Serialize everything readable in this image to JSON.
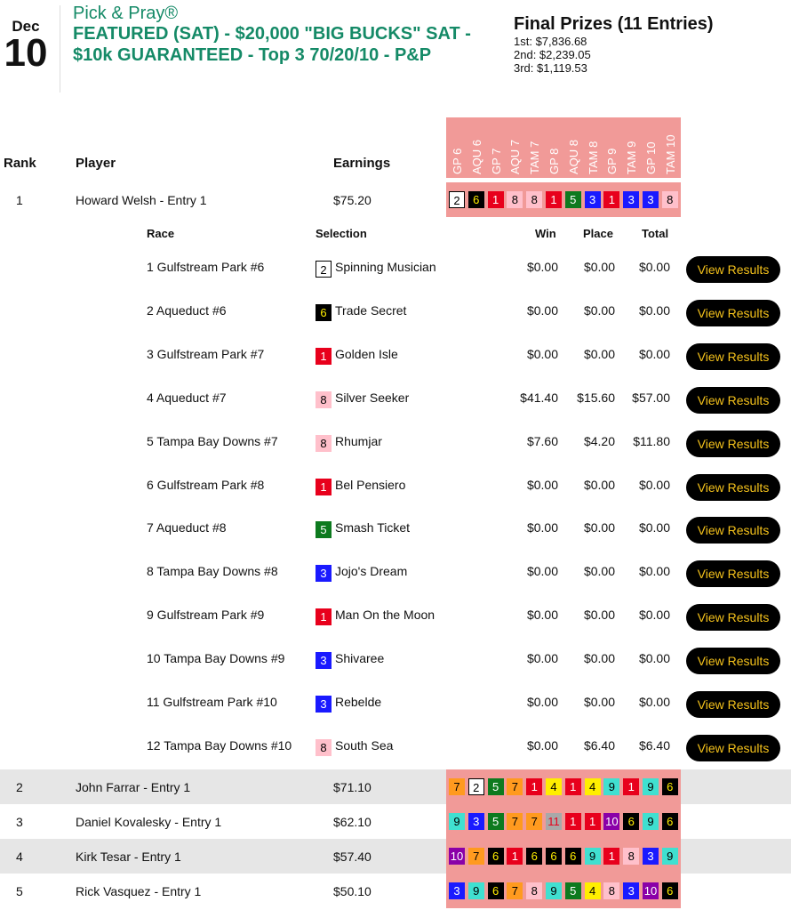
{
  "header": {
    "month": "Dec",
    "day": "10",
    "brand": "Pick & Pray®",
    "contest_name": "FEATURED (SAT) - $20,000 \"BIG BUCKS\" SAT - $10k GUARANTEED - Top 3 70/20/10 - P&P"
  },
  "prizes": {
    "title": "Final Prizes (11 Entries)",
    "lines": [
      "1st: $7,836.68",
      "2nd: $2,239.05",
      "3rd: $1,119.53"
    ]
  },
  "columns": {
    "rank": "Rank",
    "player": "Player",
    "earnings": "Earnings"
  },
  "races": [
    "GP 6",
    "AQU 6",
    "GP 7",
    "AQU 7",
    "TAM 7",
    "GP 8",
    "AQU 8",
    "TAM 8",
    "GP 9",
    "TAM 9",
    "GP 10",
    "TAM 10"
  ],
  "detail_columns": {
    "race": "Race",
    "selection": "Selection",
    "win": "Win",
    "place": "Place",
    "total": "Total"
  },
  "button_label": "View Results",
  "colors": {
    "header_strip": "#f19a98",
    "accent_green": "#158a67",
    "button_text": "#f5c21b"
  },
  "players": [
    {
      "rank": "1",
      "name": "Howard Welsh - Entry 1",
      "earnings": "$75.20",
      "picks": [
        "2",
        "6",
        "1",
        "8",
        "8",
        "1",
        "5",
        "3",
        "1",
        "3",
        "3",
        "8"
      ],
      "alt": false
    },
    {
      "rank": "2",
      "name": "John Farrar - Entry 1",
      "earnings": "$71.10",
      "picks": [
        "7",
        "2",
        "5",
        "7",
        "1",
        "4",
        "1",
        "4",
        "9",
        "1",
        "9",
        "6"
      ],
      "alt": true
    },
    {
      "rank": "3",
      "name": "Daniel Kovalesky - Entry 1",
      "earnings": "$62.10",
      "picks": [
        "9",
        "3",
        "5",
        "7",
        "7",
        "11",
        "1",
        "1",
        "10",
        "6",
        "9",
        "6"
      ],
      "alt": false
    },
    {
      "rank": "4",
      "name": "Kirk Tesar - Entry 1",
      "earnings": "$57.40",
      "picks": [
        "10",
        "7",
        "6",
        "1",
        "6",
        "6",
        "6",
        "9",
        "1",
        "8",
        "3",
        "9"
      ],
      "alt": true
    },
    {
      "rank": "5",
      "name": "Rick Vasquez - Entry 1",
      "earnings": "$50.10",
      "picks": [
        "3",
        "9",
        "6",
        "7",
        "8",
        "9",
        "5",
        "4",
        "8",
        "3",
        "10",
        "6"
      ],
      "alt": false
    }
  ],
  "details": [
    {
      "race": "1 Gulfstream Park #6",
      "pick": "2",
      "horse": "Spinning Musician",
      "win": "$0.00",
      "place": "$0.00",
      "total": "$0.00"
    },
    {
      "race": "2 Aqueduct #6",
      "pick": "6",
      "horse": "Trade Secret",
      "win": "$0.00",
      "place": "$0.00",
      "total": "$0.00"
    },
    {
      "race": "3 Gulfstream Park #7",
      "pick": "1",
      "horse": "Golden Isle",
      "win": "$0.00",
      "place": "$0.00",
      "total": "$0.00"
    },
    {
      "race": "4 Aqueduct #7",
      "pick": "8",
      "horse": "Silver Seeker",
      "win": "$41.40",
      "place": "$15.60",
      "total": "$57.00"
    },
    {
      "race": "5 Tampa Bay Downs #7",
      "pick": "8",
      "horse": "Rhumjar",
      "win": "$7.60",
      "place": "$4.20",
      "total": "$11.80"
    },
    {
      "race": "6 Gulfstream Park #8",
      "pick": "1",
      "horse": "Bel Pensiero",
      "win": "$0.00",
      "place": "$0.00",
      "total": "$0.00"
    },
    {
      "race": "7 Aqueduct #8",
      "pick": "5",
      "horse": "Smash Ticket",
      "win": "$0.00",
      "place": "$0.00",
      "total": "$0.00"
    },
    {
      "race": "8 Tampa Bay Downs #8",
      "pick": "3",
      "horse": "Jojo's Dream",
      "win": "$0.00",
      "place": "$0.00",
      "total": "$0.00"
    },
    {
      "race": "9 Gulfstream Park #9",
      "pick": "1",
      "horse": "Man On the Moon",
      "win": "$0.00",
      "place": "$0.00",
      "total": "$0.00"
    },
    {
      "race": "10 Tampa Bay Downs #9",
      "pick": "3",
      "horse": "Shivaree",
      "win": "$0.00",
      "place": "$0.00",
      "total": "$0.00"
    },
    {
      "race": "11 Gulfstream Park #10",
      "pick": "3",
      "horse": "Rebelde",
      "win": "$0.00",
      "place": "$0.00",
      "total": "$0.00"
    },
    {
      "race": "12 Tampa Bay Downs #10",
      "pick": "8",
      "horse": "South Sea",
      "win": "$0.00",
      "place": "$6.40",
      "total": "$6.40"
    }
  ],
  "saddle_cloth_colors": {
    "1": {
      "bg": "#e8001c",
      "fg": "#ffffff"
    },
    "2": {
      "bg": "#ffffff",
      "fg": "#000000",
      "border": "#000000"
    },
    "3": {
      "bg": "#1a1aff",
      "fg": "#ffffff"
    },
    "4": {
      "bg": "#ffee00",
      "fg": "#000000"
    },
    "5": {
      "bg": "#0d7a1f",
      "fg": "#ffffff"
    },
    "6": {
      "bg": "#000000",
      "fg": "#ffee00"
    },
    "7": {
      "bg": "#ff9a1f",
      "fg": "#000000"
    },
    "8": {
      "bg": "#ffc0cb",
      "fg": "#000000"
    },
    "9": {
      "bg": "#40e0d0",
      "fg": "#000000"
    },
    "10": {
      "bg": "#8a00a8",
      "fg": "#ffffff"
    },
    "11": {
      "bg": "#a8a8a8",
      "fg": "#e8001c"
    }
  }
}
